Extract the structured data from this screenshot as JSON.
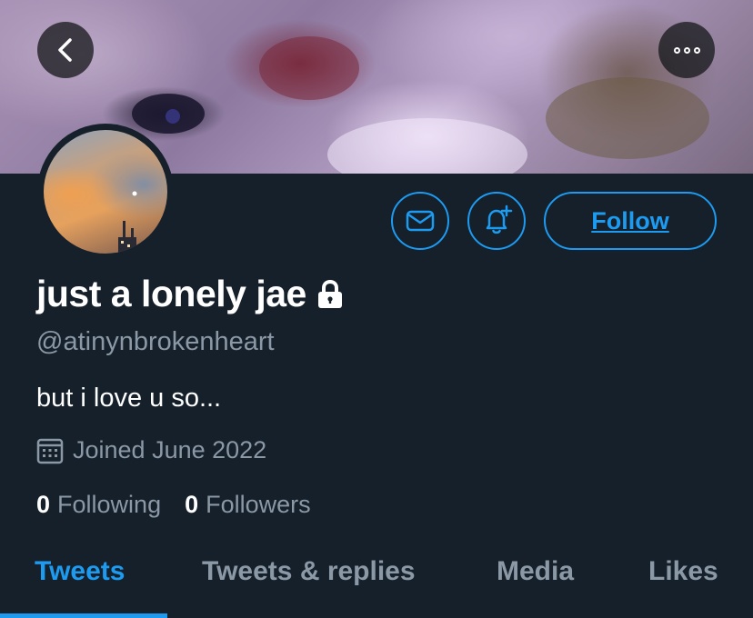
{
  "profile": {
    "display_name": "just a lonely jae",
    "handle": "@atinynbrokenheart",
    "bio": "but i love u so...",
    "joined": "Joined June 2022",
    "protected": true
  },
  "actions": {
    "follow_label": "Follow",
    "message_icon": "mail-icon",
    "notify_icon": "bell-plus-icon",
    "back_icon": "chevron-left-icon",
    "more_icon": "more-icon"
  },
  "stats": {
    "following_count": "0",
    "following_label": "Following",
    "followers_count": "0",
    "followers_label": "Followers"
  },
  "tabs": [
    {
      "label": "Tweets",
      "active": true
    },
    {
      "label": "Tweets & replies",
      "active": false
    },
    {
      "label": "Media",
      "active": false
    },
    {
      "label": "Likes",
      "active": false
    }
  ],
  "colors": {
    "background": "#15202b",
    "accent": "#1d9bf0",
    "secondary_text": "#8b98a5"
  }
}
